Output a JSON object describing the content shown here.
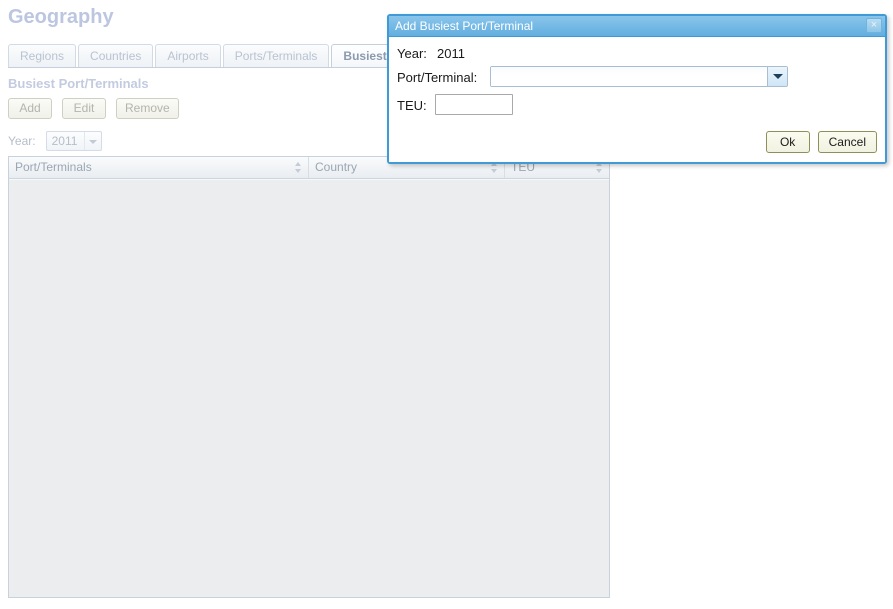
{
  "page": {
    "title": "Geography",
    "section_title": "Busiest Port/Terminals"
  },
  "tabs": [
    {
      "label": "Regions",
      "selected": false
    },
    {
      "label": "Countries",
      "selected": false
    },
    {
      "label": "Airports",
      "selected": false
    },
    {
      "label": "Ports/Terminals",
      "selected": false
    },
    {
      "label": "Busiest",
      "selected": true
    }
  ],
  "toolbar": {
    "add_label": "Add",
    "edit_label": "Edit",
    "remove_label": "Remove"
  },
  "filter": {
    "year_label": "Year:",
    "year_value": "2011"
  },
  "grid": {
    "columns": [
      {
        "label": "Port/Terminals"
      },
      {
        "label": "Country"
      },
      {
        "label": "TEU"
      }
    ],
    "rows": []
  },
  "dialog": {
    "title": "Add Busiest Port/Terminal",
    "close_glyph": "×",
    "year_label": "Year:",
    "year_value": "2011",
    "port_label": "Port/Terminal:",
    "port_value": "",
    "teu_label": "TEU:",
    "teu_value": "",
    "ok_label": "Ok",
    "cancel_label": "Cancel"
  },
  "colors": {
    "dialog_border": "#3f9ad6",
    "dialog_titlebar": "#62aee0",
    "page_title": "#bcc6e0",
    "grid_bg": "#ebedef",
    "button_face": "#f2f2e2"
  }
}
